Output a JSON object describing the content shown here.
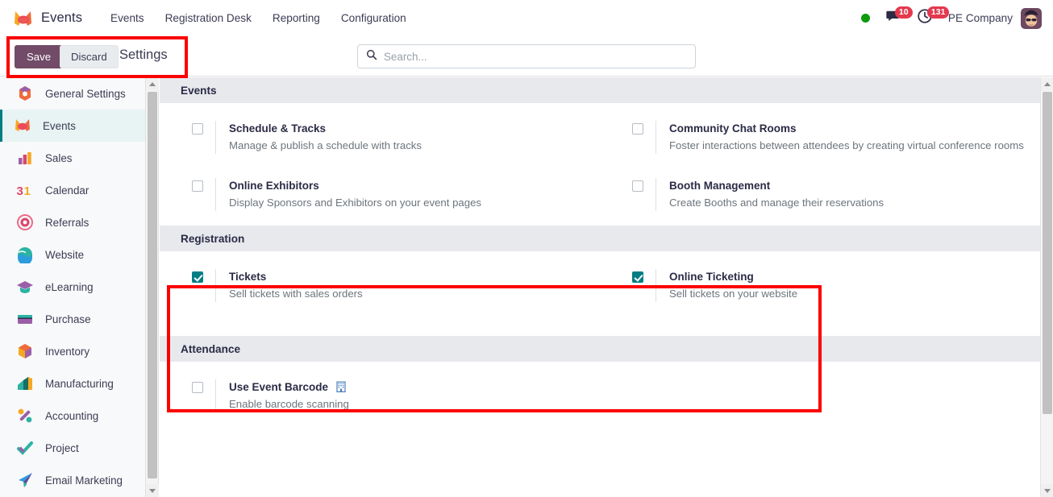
{
  "app": {
    "brand_icon": "events-logo-icon",
    "brand_name": "Events"
  },
  "navbar": {
    "items": [
      {
        "label": "Events",
        "name": "nav-events"
      },
      {
        "label": "Registration Desk",
        "name": "nav-registration-desk"
      },
      {
        "label": "Reporting",
        "name": "nav-reporting"
      },
      {
        "label": "Configuration",
        "name": "nav-configuration"
      }
    ],
    "systray": {
      "presence_icon": "green-status-dot-icon",
      "messages_icon": "chat-bubble-icon",
      "messages_count": "10",
      "activities_icon": "clock-icon",
      "activities_count": "131",
      "company": "PE Company",
      "avatar_icon": "user-avatar-icon"
    }
  },
  "toolbar": {
    "save_label": "Save",
    "discard_label": "Discard",
    "title": "Settings"
  },
  "search": {
    "icon": "search-icon",
    "placeholder": "Search...",
    "value": ""
  },
  "sidebar": {
    "scroll_up_icon": "triangle-up-icon",
    "scroll_down_icon": "triangle-down-icon",
    "items": [
      {
        "label": "General Settings",
        "icon": "settings-app-icon",
        "active": false
      },
      {
        "label": "Events",
        "icon": "events-app-icon",
        "active": true
      },
      {
        "label": "Sales",
        "icon": "sales-app-icon",
        "active": false
      },
      {
        "label": "Calendar",
        "icon": "calendar-app-icon",
        "active": false
      },
      {
        "label": "Referrals",
        "icon": "referrals-app-icon",
        "active": false
      },
      {
        "label": "Website",
        "icon": "website-app-icon",
        "active": false
      },
      {
        "label": "eLearning",
        "icon": "elearning-app-icon",
        "active": false
      },
      {
        "label": "Purchase",
        "icon": "purchase-app-icon",
        "active": false
      },
      {
        "label": "Inventory",
        "icon": "inventory-app-icon",
        "active": false
      },
      {
        "label": "Manufacturing",
        "icon": "manufacturing-app-icon",
        "active": false
      },
      {
        "label": "Accounting",
        "icon": "accounting-app-icon",
        "active": false
      },
      {
        "label": "Project",
        "icon": "project-app-icon",
        "active": false
      },
      {
        "label": "Email Marketing",
        "icon": "email-marketing-app-icon",
        "active": false
      }
    ]
  },
  "settings": {
    "sections": [
      {
        "title": "Events",
        "left": [
          {
            "title": "Schedule & Tracks",
            "desc": "Manage & publish a schedule with tracks",
            "checked": false
          },
          {
            "title": "Online Exhibitors",
            "desc": "Display Sponsors and Exhibitors on your event pages",
            "checked": false
          }
        ],
        "right": [
          {
            "title": "Community Chat Rooms",
            "desc": "Foster interactions between attendees by creating virtual conference rooms",
            "checked": false
          },
          {
            "title": "Booth Management",
            "desc": "Create Booths and manage their reservations",
            "checked": false
          }
        ]
      },
      {
        "title": "Registration",
        "left": [
          {
            "title": "Tickets",
            "desc": "Sell tickets with sales orders",
            "checked": true
          }
        ],
        "right": [
          {
            "title": "Online Ticketing",
            "desc": "Sell tickets on your website",
            "checked": true
          }
        ]
      },
      {
        "title": "Attendance",
        "left": [
          {
            "title": "Use Event Barcode",
            "desc": "Enable barcode scanning",
            "checked": false,
            "enterprise_icon": "enterprise-building-icon"
          }
        ],
        "right": []
      }
    ]
  },
  "colors": {
    "primary": "#714b67",
    "accent_teal": "#017e84",
    "section_header_bg": "#e7e9ed",
    "badge_red": "#e4384e",
    "annotation_red": "#fc0000",
    "presence_green": "#0e9b0e"
  }
}
